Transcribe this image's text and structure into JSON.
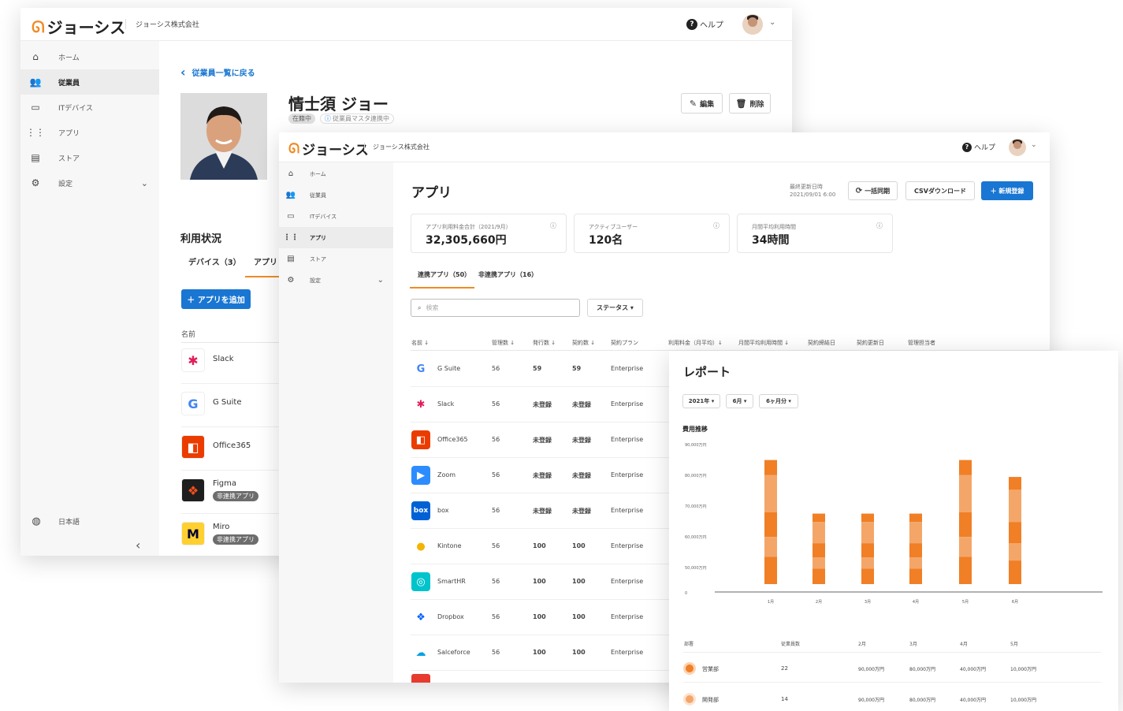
{
  "colors": {
    "brand_orange": "#f08a24",
    "primary_blue": "#1976d2",
    "bar_dark": "#f07f26",
    "bar_light": "#f4a669"
  },
  "w1": {
    "logo": "ジョーシス",
    "company": "ジョーシス株式会社",
    "help": "ヘルプ",
    "nav": [
      {
        "icon": "home-icon",
        "label": "ホーム"
      },
      {
        "icon": "people-icon",
        "label": "従業員"
      },
      {
        "icon": "laptop-icon",
        "label": "ITデバイス"
      },
      {
        "icon": "grid-icon",
        "label": "アプリ"
      },
      {
        "icon": "store-icon",
        "label": "ストア"
      },
      {
        "icon": "gear-icon",
        "label": "設定"
      }
    ],
    "language": "日本語",
    "back": "従業員一覧に戻る",
    "name": "情士須 ジョー",
    "status": "在籍中",
    "master": "従業員マスタ連携中",
    "edit": "編集",
    "delete": "削除",
    "usage_title": "利用状況",
    "tabs": [
      "デバイス（3）",
      "アプリ"
    ],
    "add_app": "＋ アプリを追加",
    "col_name": "名前",
    "apps": [
      {
        "name": "Slack",
        "tag": ""
      },
      {
        "name": "G Suite",
        "tag": ""
      },
      {
        "name": "Office365",
        "tag": ""
      },
      {
        "name": "Figma",
        "tag": "非連携アプリ"
      },
      {
        "name": "Miro",
        "tag": "非連携アプリ"
      }
    ]
  },
  "w2": {
    "logo": "ジョーシス",
    "company": "ジョーシス株式会社",
    "help": "ヘルプ",
    "nav": [
      "ホーム",
      "従業員",
      "ITデバイス",
      "アプリ",
      "ストア",
      "設定"
    ],
    "title": "アプリ",
    "updated_label": "最終更新日時",
    "updated_value": "2021/09/01 6:00",
    "sync_btn": "一括同期",
    "csv_btn": "CSVダウンロード",
    "new_btn": "＋ 新規登録",
    "kpis": [
      {
        "label": "アプリ利用料金合計（2021/9月）",
        "value": "32,305,660円"
      },
      {
        "label": "アクティブユーザー",
        "value": "120名"
      },
      {
        "label": "月間平均利用時間",
        "value": "34時間"
      }
    ],
    "tabs": [
      "連携アプリ（50）",
      "非連携アプリ（16）"
    ],
    "search_placeholder": "検索",
    "status_filter": "ステータス ▾",
    "columns": [
      "名前 ↓",
      "管理数 ↓",
      "発行数 ↓",
      "契約数 ↓",
      "契約プラン",
      "利用料金（月平均）↓",
      "月間平均利用時間 ↓",
      "契約締結日",
      "契約更新日",
      "管理担当者"
    ],
    "rows": [
      {
        "name": "G Suite",
        "a": "56",
        "b": "59",
        "c": "59",
        "plan": "Enterprise"
      },
      {
        "name": "Slack",
        "a": "56",
        "b": "未登録",
        "c": "未登録",
        "plan": "Enterprise"
      },
      {
        "name": "Office365",
        "a": "56",
        "b": "未登録",
        "c": "未登録",
        "plan": "Enterprise"
      },
      {
        "name": "Zoom",
        "a": "56",
        "b": "未登録",
        "c": "未登録",
        "plan": "Enterprise"
      },
      {
        "name": "box",
        "a": "56",
        "b": "未登録",
        "c": "未登録",
        "plan": "Enterprise"
      },
      {
        "name": "Kintone",
        "a": "56",
        "b": "100",
        "c": "100",
        "plan": "Enterprise"
      },
      {
        "name": "SmartHR",
        "a": "56",
        "b": "100",
        "c": "100",
        "plan": "Enterprise"
      },
      {
        "name": "Dropbox",
        "a": "56",
        "b": "100",
        "c": "100",
        "plan": "Enterprise"
      },
      {
        "name": "Salceforce",
        "a": "56",
        "b": "100",
        "c": "100",
        "plan": "Enterprise"
      }
    ]
  },
  "w3": {
    "title": "レポート",
    "filters": [
      "2021年 ▾",
      "6月 ▾",
      "6ヶ月分 ▾"
    ],
    "chart_title": "費用推移",
    "dept_header": [
      "部署",
      "従業員数",
      "2月",
      "3月",
      "4月",
      "5月"
    ],
    "depts": [
      {
        "name": "営業部",
        "count": "22",
        "v": [
          "90,000万円",
          "80,000万円",
          "40,000万円",
          "10,000万円"
        ]
      },
      {
        "name": "開発部",
        "count": "14",
        "v": [
          "90,000万円",
          "80,000万円",
          "40,000万円",
          "10,000万円"
        ]
      }
    ]
  },
  "chart_data": {
    "type": "bar",
    "title": "費用推移",
    "categories": [
      "1月",
      "2月",
      "3月",
      "4月",
      "5月",
      "6月"
    ],
    "values": [
      84000,
      65000,
      65000,
      65000,
      84000,
      78000
    ],
    "yticks": [
      "90,000万円",
      "80,000万円",
      "70,000万円",
      "60,000万円",
      "50,000万円",
      "0"
    ],
    "ylim": [
      40000,
      92000
    ]
  }
}
